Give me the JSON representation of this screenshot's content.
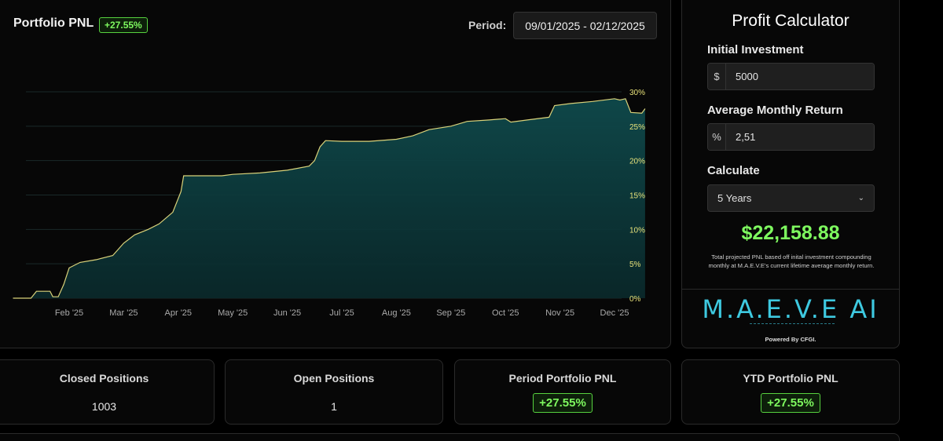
{
  "chart_panel": {
    "title": "Portfolio PNL",
    "badge": "+27.55%",
    "period_label": "Period:",
    "period_value": "09/01/2025 - 02/12/2025"
  },
  "chart_data": {
    "type": "area",
    "x_tick_labels": [
      "Feb '25",
      "Mar '25",
      "Apr '25",
      "May '25",
      "Jun '25",
      "Jul '25",
      "Aug '25",
      "Sep '25",
      "Oct '25",
      "Nov '25",
      "Dec '25"
    ],
    "y_tick_labels": [
      "0%",
      "5%",
      "10%",
      "15%",
      "20%",
      "25%",
      "30%"
    ],
    "ylim": [
      0,
      30
    ],
    "x_months": [
      0.97,
      11.4
    ],
    "points": [
      [
        0.97,
        0.0
      ],
      [
        1.3,
        0.0
      ],
      [
        1.4,
        1.0
      ],
      [
        1.65,
        1.0
      ],
      [
        1.7,
        0.2
      ],
      [
        1.8,
        0.2
      ],
      [
        1.9,
        2.0
      ],
      [
        2.0,
        4.4
      ],
      [
        2.2,
        5.2
      ],
      [
        2.5,
        5.6
      ],
      [
        2.8,
        6.2
      ],
      [
        3.0,
        8.0
      ],
      [
        3.2,
        9.2
      ],
      [
        3.45,
        10.0
      ],
      [
        3.65,
        10.8
      ],
      [
        3.9,
        12.5
      ],
      [
        4.05,
        15.5
      ],
      [
        4.1,
        17.8
      ],
      [
        4.4,
        17.8
      ],
      [
        4.8,
        17.8
      ],
      [
        5.0,
        18.0
      ],
      [
        5.5,
        18.2
      ],
      [
        6.0,
        18.6
      ],
      [
        6.4,
        19.2
      ],
      [
        6.5,
        20.0
      ],
      [
        6.6,
        22.0
      ],
      [
        6.7,
        22.9
      ],
      [
        7.0,
        22.8
      ],
      [
        7.5,
        22.8
      ],
      [
        8.0,
        23.1
      ],
      [
        8.3,
        23.6
      ],
      [
        8.6,
        24.5
      ],
      [
        9.0,
        25.0
      ],
      [
        9.3,
        25.7
      ],
      [
        9.7,
        25.9
      ],
      [
        10.0,
        26.1
      ],
      [
        10.1,
        25.6
      ],
      [
        10.4,
        25.9
      ],
      [
        10.8,
        26.3
      ],
      [
        10.9,
        28.0
      ],
      [
        11.2,
        28.3
      ],
      [
        11.6,
        28.6
      ],
      [
        12.0,
        29.0
      ],
      [
        12.1,
        28.8
      ],
      [
        12.2,
        29.0
      ],
      [
        12.3,
        27.0
      ],
      [
        12.5,
        26.9
      ],
      [
        12.56,
        27.55
      ]
    ],
    "line_color": "#d9d27a",
    "fill_color": "#0f4648",
    "grid": true
  },
  "calculator": {
    "title": "Profit Calculator",
    "initial_investment_label": "Initial Investment",
    "initial_investment_prefix": "$",
    "initial_investment_value": "5000",
    "monthly_return_label": "Average Monthly Return",
    "monthly_return_prefix": "%",
    "monthly_return_value": "2,51",
    "calculate_label": "Calculate",
    "calculate_selected": "5 Years",
    "result": "$22,158.88",
    "result_note": "Total projected PNL based off inital investment compounding monthly at M.A.E.V.E's current lifetime average monthly return.",
    "brand_logo": "M.A.E.V.E AI",
    "powered_by": "Powered By CFGI."
  },
  "stats": {
    "closed_positions_label": "Closed Positions",
    "closed_positions_value": "1003",
    "open_positions_label": "Open Positions",
    "open_positions_value": "1",
    "period_pnl_label": "Period Portfolio PNL",
    "period_pnl_value": "+27.55%",
    "ytd_pnl_label": "YTD Portfolio PNL",
    "ytd_pnl_value": "+27.55%"
  },
  "colors": {
    "accent_green": "#7ef95f",
    "brand_cyan": "#3ec9e0",
    "background": "#000000"
  }
}
